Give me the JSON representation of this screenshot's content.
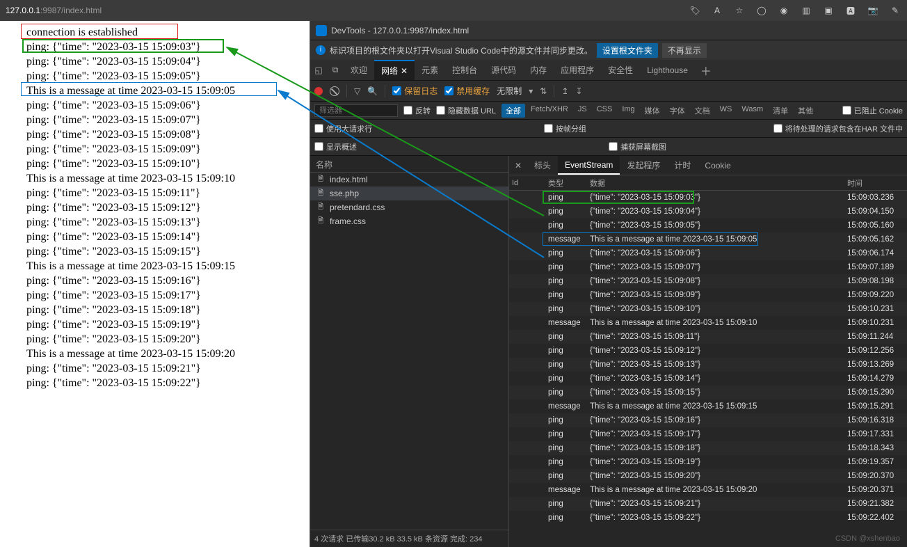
{
  "browser": {
    "url_host": "127.0.0.1",
    "url_port": ":9987",
    "url_path": "/index.html",
    "icons": [
      "tag-icon",
      "text-icon",
      "star-icon",
      "ext1-icon",
      "ext2-icon",
      "ext3-icon",
      "ext4-icon",
      "translate-icon",
      "camera-icon",
      "brush-icon"
    ]
  },
  "devtools": {
    "title": "DevTools - 127.0.0.1:9987/index.html",
    "notice_text": "标识项目的根文件夹以打开Visual Studio Code中的源文件并同步更改。",
    "notice_btn1": "设置根文件夹",
    "notice_btn2": "不再显示",
    "tabs": [
      "欢迎",
      "网络",
      "元素",
      "控制台",
      "源代码",
      "内存",
      "应用程序",
      "安全性",
      "Lighthouse"
    ],
    "active_tab": "网络",
    "toolbar": {
      "preserve_log": "保留日志",
      "disable_cache": "禁用缓存",
      "throttle": "无限制"
    },
    "filter": {
      "placeholder": "筛选器",
      "invert": "反转",
      "hide_data_url": "隐藏数据 URL",
      "types": [
        "全部",
        "Fetch/XHR",
        "JS",
        "CSS",
        "Img",
        "媒体",
        "字体",
        "文档",
        "WS",
        "Wasm",
        "清单",
        "其他"
      ],
      "blocked": "已阻止 Cookie"
    },
    "row2": {
      "large_rows": "使用大请求行",
      "group_by_frame": "按帧分组",
      "har_pending": "将待处理的请求包含在HAR 文件中",
      "show_overview": "显示概述",
      "screenshots": "捕获屏幕截图"
    },
    "reqlist_header": "名称",
    "requests": [
      {
        "name": "index.html",
        "icon": "doc"
      },
      {
        "name": "sse.php",
        "icon": "doc",
        "selected": true
      },
      {
        "name": "pretendard.css",
        "icon": "css"
      },
      {
        "name": "frame.css",
        "icon": "css"
      }
    ],
    "status_text": "4 次请求  已传输30.2 kB  33.5 kB 条资源  完成: 234",
    "detail_tabs": [
      "标头",
      "EventStream",
      "发起程序",
      "计时",
      "Cookie"
    ],
    "detail_active": "EventStream",
    "ev_headers": {
      "id": "Id",
      "type": "类型",
      "data": "数据",
      "time": "时间"
    },
    "events": [
      {
        "type": "ping",
        "data": "{\"time\": \"2023-03-15 15:09:03\"}",
        "time": "15:09:03.236",
        "hl": "green"
      },
      {
        "type": "ping",
        "data": "{\"time\": \"2023-03-15 15:09:04\"}",
        "time": "15:09:04.150"
      },
      {
        "type": "ping",
        "data": "{\"time\": \"2023-03-15 15:09:05\"}",
        "time": "15:09:05.160"
      },
      {
        "type": "message",
        "data": "This is a message at time 2023-03-15 15:09:05",
        "time": "15:09:05.162",
        "hl": "blue"
      },
      {
        "type": "ping",
        "data": "{\"time\": \"2023-03-15 15:09:06\"}",
        "time": "15:09:06.174"
      },
      {
        "type": "ping",
        "data": "{\"time\": \"2023-03-15 15:09:07\"}",
        "time": "15:09:07.189"
      },
      {
        "type": "ping",
        "data": "{\"time\": \"2023-03-15 15:09:08\"}",
        "time": "15:09:08.198"
      },
      {
        "type": "ping",
        "data": "{\"time\": \"2023-03-15 15:09:09\"}",
        "time": "15:09:09.220"
      },
      {
        "type": "ping",
        "data": "{\"time\": \"2023-03-15 15:09:10\"}",
        "time": "15:09:10.231"
      },
      {
        "type": "message",
        "data": "This is a message at time 2023-03-15 15:09:10",
        "time": "15:09:10.231"
      },
      {
        "type": "ping",
        "data": "{\"time\": \"2023-03-15 15:09:11\"}",
        "time": "15:09:11.244"
      },
      {
        "type": "ping",
        "data": "{\"time\": \"2023-03-15 15:09:12\"}",
        "time": "15:09:12.256"
      },
      {
        "type": "ping",
        "data": "{\"time\": \"2023-03-15 15:09:13\"}",
        "time": "15:09:13.269"
      },
      {
        "type": "ping",
        "data": "{\"time\": \"2023-03-15 15:09:14\"}",
        "time": "15:09:14.279"
      },
      {
        "type": "ping",
        "data": "{\"time\": \"2023-03-15 15:09:15\"}",
        "time": "15:09:15.290"
      },
      {
        "type": "message",
        "data": "This is a message at time 2023-03-15 15:09:15",
        "time": "15:09:15.291"
      },
      {
        "type": "ping",
        "data": "{\"time\": \"2023-03-15 15:09:16\"}",
        "time": "15:09:16.318"
      },
      {
        "type": "ping",
        "data": "{\"time\": \"2023-03-15 15:09:17\"}",
        "time": "15:09:17.331"
      },
      {
        "type": "ping",
        "data": "{\"time\": \"2023-03-15 15:09:18\"}",
        "time": "15:09:18.343"
      },
      {
        "type": "ping",
        "data": "{\"time\": \"2023-03-15 15:09:19\"}",
        "time": "15:09:19.357"
      },
      {
        "type": "ping",
        "data": "{\"time\": \"2023-03-15 15:09:20\"}",
        "time": "15:09:20.370"
      },
      {
        "type": "message",
        "data": "This is a message at time 2023-03-15 15:09:20",
        "time": "15:09:20.371"
      },
      {
        "type": "ping",
        "data": "{\"time\": \"2023-03-15 15:09:21\"}",
        "time": "15:09:21.382"
      },
      {
        "type": "ping",
        "data": "{\"time\": \"2023-03-15 15:09:22\"}",
        "time": "15:09:22.402"
      }
    ]
  },
  "page_lines": [
    "connection is established",
    "ping: {\"time\": \"2023-03-15 15:09:03\"}",
    "ping: {\"time\": \"2023-03-15 15:09:04\"}",
    "ping: {\"time\": \"2023-03-15 15:09:05\"}",
    "This is a message at time 2023-03-15 15:09:05",
    "ping: {\"time\": \"2023-03-15 15:09:06\"}",
    "ping: {\"time\": \"2023-03-15 15:09:07\"}",
    "ping: {\"time\": \"2023-03-15 15:09:08\"}",
    "ping: {\"time\": \"2023-03-15 15:09:09\"}",
    "ping: {\"time\": \"2023-03-15 15:09:10\"}",
    "This is a message at time 2023-03-15 15:09:10",
    "ping: {\"time\": \"2023-03-15 15:09:11\"}",
    "ping: {\"time\": \"2023-03-15 15:09:12\"}",
    "ping: {\"time\": \"2023-03-15 15:09:13\"}",
    "ping: {\"time\": \"2023-03-15 15:09:14\"}",
    "ping: {\"time\": \"2023-03-15 15:09:15\"}",
    "This is a message at time 2023-03-15 15:09:15",
    "ping: {\"time\": \"2023-03-15 15:09:16\"}",
    "ping: {\"time\": \"2023-03-15 15:09:17\"}",
    "ping: {\"time\": \"2023-03-15 15:09:18\"}",
    "ping: {\"time\": \"2023-03-15 15:09:19\"}",
    "ping: {\"time\": \"2023-03-15 15:09:20\"}",
    "This is a message at time 2023-03-15 15:09:20",
    "ping: {\"time\": \"2023-03-15 15:09:21\"}",
    "ping: {\"time\": \"2023-03-15 15:09:22\"}"
  ],
  "watermark": "CSDN @xshenbao"
}
